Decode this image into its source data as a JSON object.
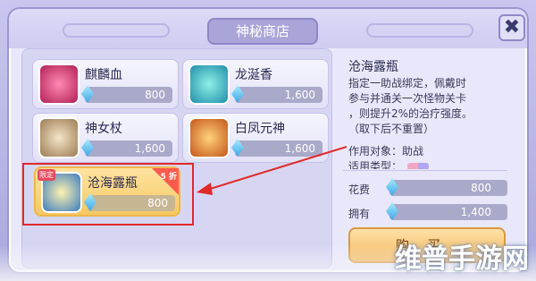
{
  "window": {
    "title": "神秘商店",
    "close_label": "✖"
  },
  "items": [
    {
      "name": "麒麟血",
      "price": "800",
      "thumb_color": "#d43a6a",
      "icon": "flower-icon"
    },
    {
      "name": "龙涎香",
      "price": "1,600",
      "thumb_color": "#2fb6c9",
      "icon": "dragon-icon"
    },
    {
      "name": "神女杖",
      "price": "1,600",
      "thumb_color": "#b49470",
      "icon": "staff-icon"
    },
    {
      "name": "白凤元神",
      "price": "1,600",
      "thumb_color": "#e07a2c",
      "icon": "phoenix-icon"
    },
    {
      "name": "沧海露瓶",
      "price": "800",
      "thumb_color": "#4e8cc8",
      "icon": "bottle-icon",
      "badge_new": "限定",
      "badge_discount": "5 折"
    }
  ],
  "detail": {
    "title": "沧海露瓶",
    "desc_lines": [
      "指定一助战绑定，佩戴时",
      "参与并通关一次怪物关卡",
      "，则提升2%的治疗强度。",
      "（取下后不重置）"
    ],
    "scope": "作用对象：助战",
    "type_label": "适用类型："
  },
  "stats": {
    "cost_label": "花费",
    "cost_value": "800",
    "own_label": "拥有",
    "own_value": "1,400"
  },
  "buy_label": "购买",
  "watermark": "维普手游网",
  "colors": {
    "accent": "#f0b64a",
    "highlight": "#e02a2a"
  }
}
